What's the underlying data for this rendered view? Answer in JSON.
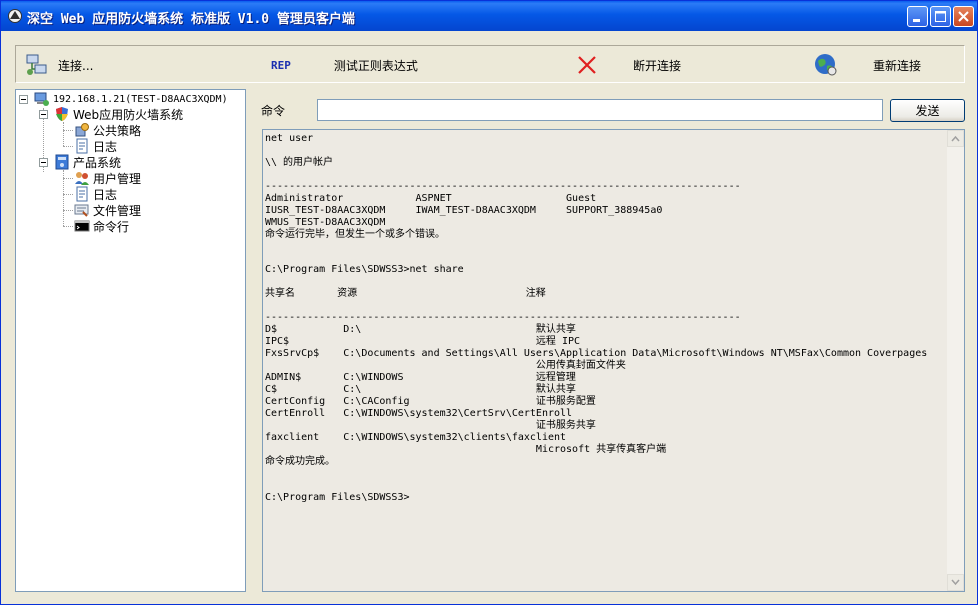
{
  "window": {
    "title": "深空 Web 应用防火墙系统 标准版 V1.0 管理员客户端",
    "title_bar_color": "#0554E3"
  },
  "toolbar": {
    "connect_label": "连接...",
    "rep_label": "REP",
    "test_regex_label": "测试正则表达式",
    "disconnect_label": "断开连接",
    "reconnect_label": "重新连接",
    "rep_color": "#1A2FB0",
    "disconnect_color": "#E02020"
  },
  "tree": {
    "root": "192.168.1.21(TEST-D8AAC3XQDM)",
    "groups": [
      {
        "label": "Web应用防火墙系统",
        "children": [
          "公共策略",
          "日志"
        ]
      },
      {
        "label": "产品系统",
        "children": [
          "用户管理",
          "日志",
          "文件管理",
          "命令行"
        ]
      }
    ],
    "selected": "命令行"
  },
  "command": {
    "label": "命令",
    "value": "",
    "send_label": "发送"
  },
  "output": {
    "lines": [
      "net user",
      "",
      "\\\\ 的用户帐户",
      "",
      "-------------------------------------------------------------------------------",
      "Administrator            ASPNET                   Guest",
      "IUSR_TEST-D8AAC3XQDM     IWAM_TEST-D8AAC3XQDM     SUPPORT_388945a0",
      "WMUS_TEST-D8AAC3XQDM",
      "命令运行完毕，但发生一个或多个错误。",
      "",
      "",
      "C:\\Program Files\\SDWSS3>net share",
      "",
      "共享名       资源                            注释",
      "",
      "-------------------------------------------------------------------------------",
      "D$           D:\\                             默认共享",
      "IPC$                                         远程 IPC",
      "FxsSrvCp$    C:\\Documents and Settings\\All Users\\Application Data\\Microsoft\\Windows NT\\MSFax\\Common Coverpages",
      "                                             公用传真封面文件夹",
      "ADMIN$       C:\\WINDOWS                      远程管理",
      "C$           C:\\                             默认共享",
      "CertConfig   C:\\CAConfig                     证书服务配置",
      "CertEnroll   C:\\WINDOWS\\system32\\CertSrv\\CertEnroll",
      "                                             证书服务共享",
      "faxclient    C:\\WINDOWS\\system32\\clients\\faxclient",
      "                                             Microsoft 共享传真客户端",
      "命令成功完成。",
      "",
      "",
      "C:\\Program Files\\SDWSS3>"
    ]
  }
}
